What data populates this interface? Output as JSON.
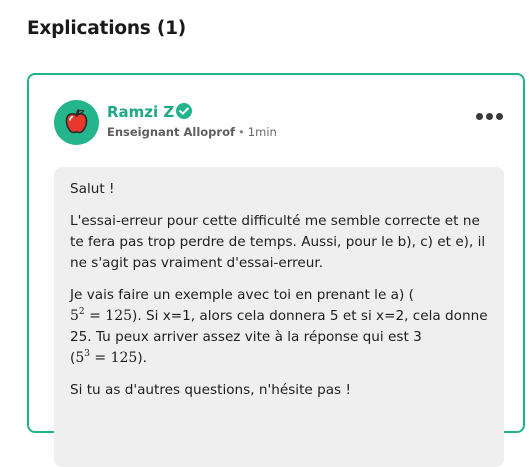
{
  "section": {
    "title": "Explications (1)"
  },
  "answer": {
    "author": {
      "name": "Ramzi Z",
      "verified_icon": "verified-check-icon",
      "avatar_icon": "apple-icon",
      "role": "Enseignant Alloprof",
      "separator": "•",
      "time": "1min"
    },
    "more_icon": "more-dots-icon",
    "body": {
      "p1": "Salut !",
      "p2": "L'essai-erreur pour cette difficulté me semble correcte et ne te fera pas trop perdre de temps. Aussi, pour le b), c) et e), il ne s'agit pas vraiment d'essai-erreur.",
      "p3_a": "Je vais faire un exemple avec toi en prenant le a) (",
      "p3_math1_base": "5",
      "p3_math1_exp": "2",
      "p3_math1_rest": " = 125",
      "p3_b": "). Si x=1, alors cela donnera 5 et si x=2, cela donne 25. Tu peux arriver assez vite à la réponse qui est 3 (",
      "p3_math2_base": "5",
      "p3_math2_exp": "3",
      "p3_math2_rest": " = 125",
      "p3_c": ").",
      "p4": "Si tu as d'autres questions, n'hésite pas !"
    }
  },
  "colors": {
    "accent": "#21b38a",
    "author_name": "#1fa886",
    "body_background": "#efefef"
  }
}
